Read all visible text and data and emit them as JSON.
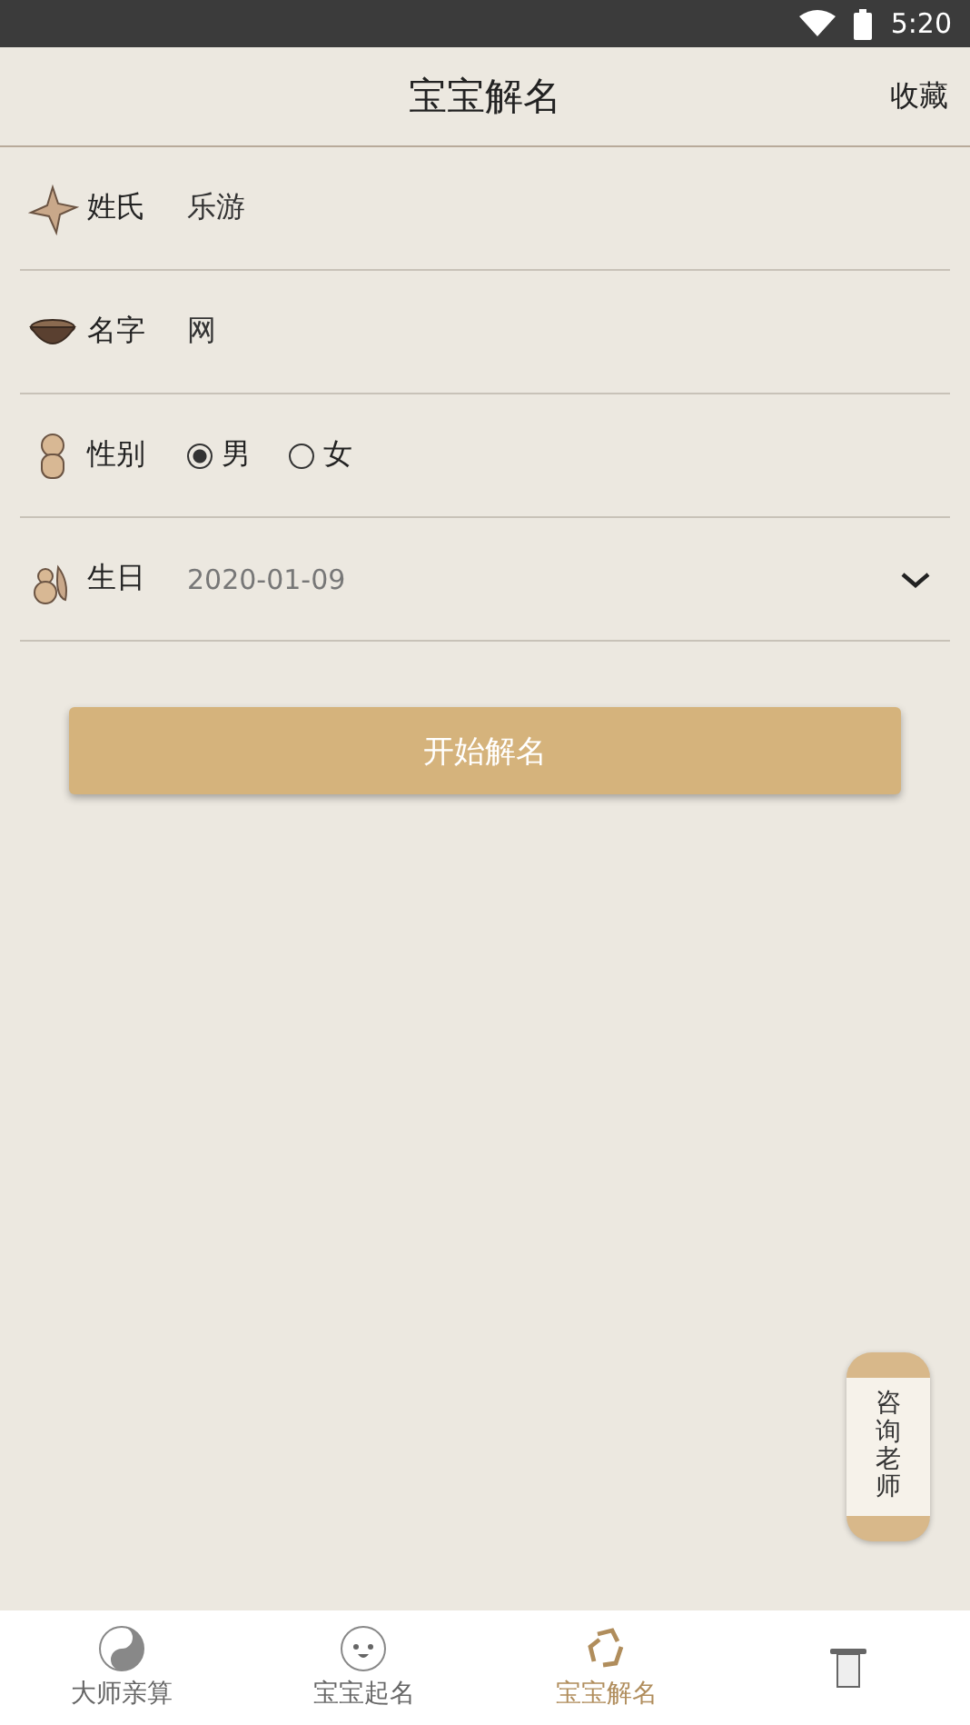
{
  "status_bar": {
    "time": "5:20"
  },
  "header": {
    "title": "宝宝解名",
    "action": "收藏"
  },
  "form": [
    {
      "kind": "text",
      "label": "姓氏",
      "value": "乐游"
    },
    {
      "kind": "text",
      "label": "名字",
      "value": "网"
    },
    {
      "kind": "radio",
      "label": "性别",
      "options": [
        {
          "label": "男",
          "selected": true
        },
        {
          "label": "女",
          "selected": false
        }
      ]
    },
    {
      "kind": "date",
      "label": "生日",
      "value": "2020-01-09"
    }
  ],
  "submit_button": "开始解名",
  "consult_button": "咨询老师",
  "tabs": [
    {
      "label": "大师亲算",
      "selected": false
    },
    {
      "label": "宝宝起名",
      "selected": false
    },
    {
      "label": "宝宝解名",
      "selected": true
    },
    {
      "selected": false
    }
  ]
}
